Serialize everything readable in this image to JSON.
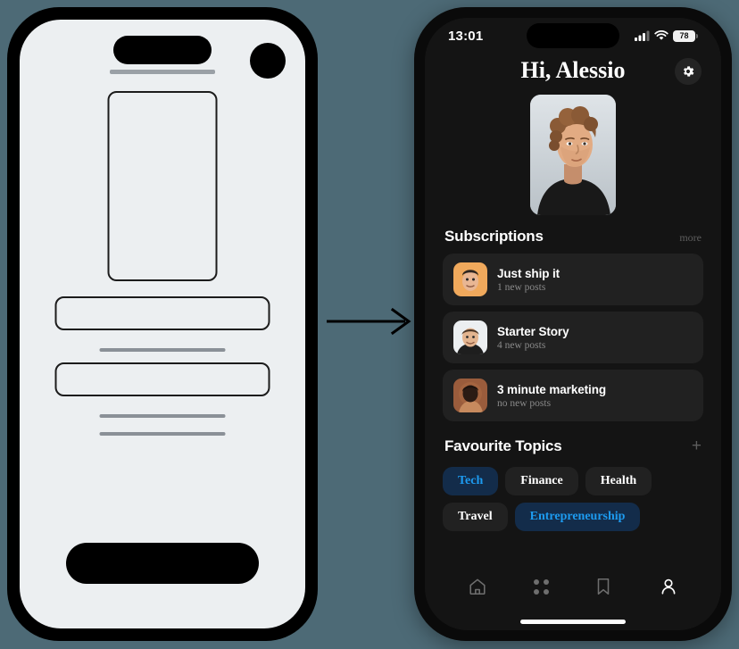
{
  "background_color": "#4d6a76",
  "arrow": {
    "icon": "arrow-right-icon"
  },
  "wireframe": {
    "label": "wireframe-mockup",
    "screen_color": "#eceff1",
    "elements": [
      "notch-pill",
      "notch-underline",
      "camera-circle",
      "image-placeholder",
      "field-1",
      "field-2",
      "text-line-1",
      "text-line-2",
      "text-line-3",
      "cta-button"
    ]
  },
  "phone": {
    "status_bar": {
      "time": "13:01",
      "cellular_icon": "cellular-bars-icon",
      "wifi_icon": "wifi-icon",
      "battery_level": "78"
    },
    "header": {
      "greeting": "Hi, Alessio",
      "settings_icon": "gear-icon"
    },
    "profile": {
      "avatar_name": "profile-photo",
      "alt": "Portrait of Alessio"
    },
    "subscriptions": {
      "title": "Subscriptions",
      "more_label": "more",
      "items": [
        {
          "name": "Just ship it",
          "meta": "1 new posts",
          "avatar_bg": "#f0a95c"
        },
        {
          "name": "Starter Story",
          "meta": "4 new posts",
          "avatar_bg": "#e8ebef"
        },
        {
          "name": "3 minute marketing",
          "meta": "no new posts",
          "avatar_bg": "#9a5c3c"
        }
      ]
    },
    "favourite_topics": {
      "title": "Favourite Topics",
      "add_icon": "plus-icon",
      "active_bg": "#132c4a",
      "active_color": "#1d9bf0",
      "items": [
        {
          "label": "Tech",
          "active": true
        },
        {
          "label": "Finance",
          "active": false
        },
        {
          "label": "Health",
          "active": false
        },
        {
          "label": "Travel",
          "active": false
        },
        {
          "label": "Entrepreneurship",
          "active": true
        }
      ]
    },
    "tabbar": {
      "items": [
        {
          "icon": "home-icon",
          "active": false
        },
        {
          "icon": "grid-icon",
          "active": false
        },
        {
          "icon": "bookmark-icon",
          "active": false
        },
        {
          "icon": "person-icon",
          "active": true
        }
      ]
    }
  }
}
